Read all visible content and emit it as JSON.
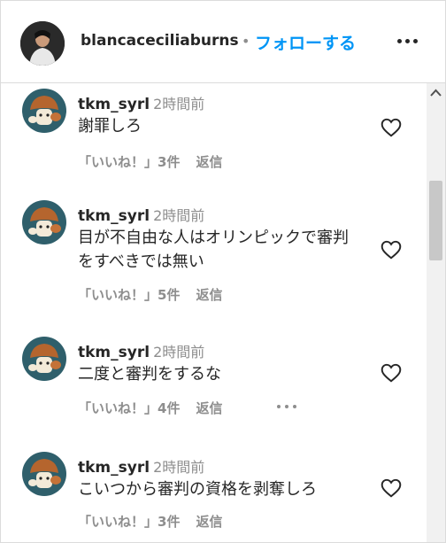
{
  "header": {
    "username": "blancaceciliaburns",
    "separator": "•",
    "follow_label": "フォローする"
  },
  "comments": [
    {
      "username": "tkm_syrl",
      "time": "2時間前",
      "text": "謝罪しろ",
      "likes": "「いいね！」3件",
      "reply_label": "返信"
    },
    {
      "username": "tkm_syrl",
      "time": "2時間前",
      "text": "目が不自由な人はオリンピックで審判をすべきでは無い",
      "likes": "「いいね！」5件",
      "reply_label": "返信"
    },
    {
      "username": "tkm_syrl",
      "time": "2時間前",
      "text": "二度と審判をするな",
      "likes": "「いいね！」4件",
      "reply_label": "返信"
    },
    {
      "username": "tkm_syrl",
      "time": "2時間前",
      "text": "こいつから審判の資格を剥奪しろ",
      "likes": "「いいね！」3件",
      "reply_label": "返信"
    }
  ],
  "colors": {
    "accent": "#0095f6",
    "secondary_text": "#8e8e8e",
    "avatar_bg": "#2f5f6b"
  },
  "icons": {
    "like": "heart-icon",
    "more": "more-options-icon",
    "scroll": "scroll-up-arrow-icon"
  }
}
